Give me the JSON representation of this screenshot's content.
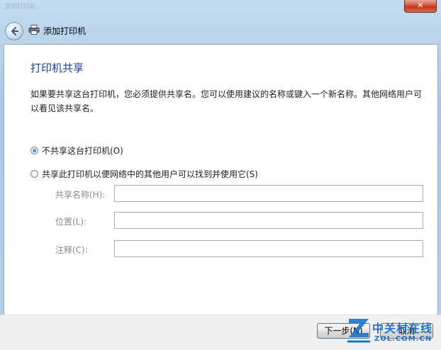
{
  "window": {
    "title": "添加打印机",
    "close_label": "✕",
    "nav_title": "添加打印机"
  },
  "page": {
    "heading": "打印机共享",
    "description": "如果要共享这台打印机，您必须提供共享名。您可以使用建议的名称或键入一个新名称。其他网络用户可以看见该共享名。"
  },
  "options": [
    {
      "label": "不共享这台打印机(O)",
      "checked": true
    },
    {
      "label": "共享此打印机以便网络中的其他用户可以找到并使用它(S)",
      "checked": false
    }
  ],
  "fields": [
    {
      "label": "共享名称(H):",
      "value": ""
    },
    {
      "label": "位置(L):",
      "value": ""
    },
    {
      "label": "注释(C):",
      "value": ""
    }
  ],
  "buttons": {
    "next": "下一步(N)",
    "cancel": "取消"
  },
  "watermark": {
    "brand_cn": "中关村在线",
    "brand_en": "ZOL.COM.CN"
  }
}
